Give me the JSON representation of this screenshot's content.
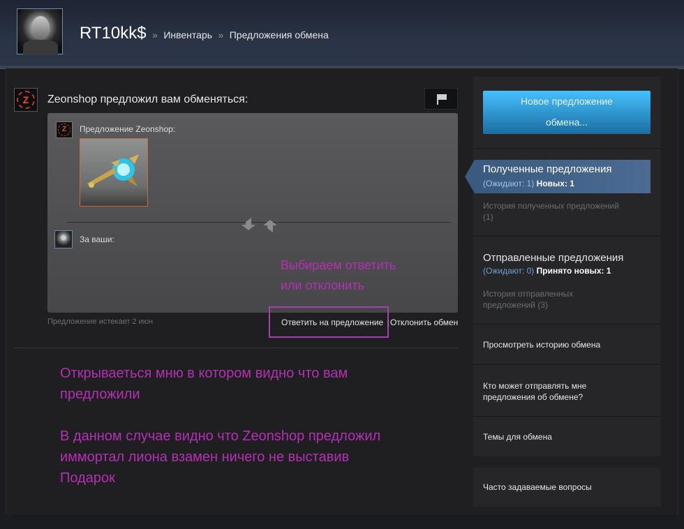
{
  "header": {
    "username": "RT10kk$",
    "separator": "»",
    "crumb_inventory": "Инвентарь",
    "crumb_offers": "Предложения обмена"
  },
  "offer": {
    "title": "Zeonshop предложил вам обменяться:",
    "their_label": "Предложение Zeonshop:",
    "your_label": "За ваши:",
    "expires": "Предложение истекает 2 июн",
    "respond": "Ответить на предложение",
    "separator": "|",
    "decline": "Отклонить обмен"
  },
  "annotations": {
    "choose_1": "Выбираем ответить",
    "choose_2": "или отклонить",
    "menu_1": "Открываеться мню в котором видно что вам",
    "menu_2": "предложили",
    "case_1": "В данном случае видно что Zeonshop предложил",
    "case_2": "иммортал лиона взамен ничего не выставив",
    "case_3": "Подарок"
  },
  "sidebar": {
    "new_offer_1": "Новое предложение",
    "new_offer_2": "обмена...",
    "received_title": "Полученные предложения",
    "received_waiting": "(Ожидают: 1)",
    "received_new": "Новых: 1",
    "received_history_1": "История полученных предложений",
    "received_history_2": "(1)",
    "sent_title": "Отправленные предложения",
    "sent_waiting": "(Ожидают: 0)",
    "sent_new": "Принято новых: 1",
    "sent_history_1": "История отправленных",
    "sent_history_2": "предложений (3)",
    "trade_history": "Просмотреть историю обмена",
    "who_can_1": "Кто может отправлять мне",
    "who_can_2": "предложения об обмене?",
    "topics": "Темы для обмена",
    "faq": "Часто задаваемые вопросы"
  },
  "colors": {
    "accent_blue": "#47bfff",
    "annotation_magenta": "#b52fb5",
    "item_border_orange": "#cf6a32"
  }
}
